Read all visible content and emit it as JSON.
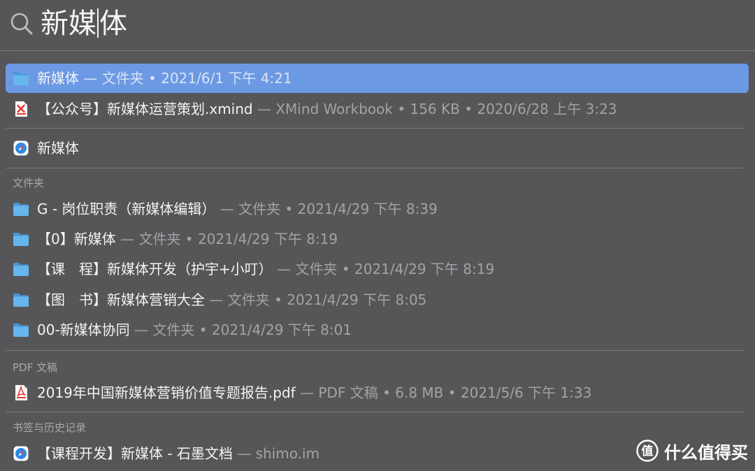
{
  "search": {
    "query_before_cursor": "新媒",
    "query_after_cursor": "体"
  },
  "rows": [
    {
      "icon": "folder-icon",
      "title": "新媒体",
      "meta": " — 文件夹 • 2021/6/1 下午 4:21"
    },
    {
      "icon": "xmind-file-icon",
      "title": "【公众号】新媒体运营策划.xmind",
      "meta": " — XMind Workbook • 156 KB • 2020/6/28 上午 3:23"
    },
    {
      "icon": "safari-icon",
      "title": "新媒体",
      "meta": ""
    },
    {
      "icon": "folder-icon",
      "title": "G - 岗位职责（新媒体编辑）",
      "meta": " — 文件夹 • 2021/4/29 下午 8:39"
    },
    {
      "icon": "folder-icon",
      "title": "【0】新媒体",
      "meta": " — 文件夹 • 2021/4/29 下午 8:19"
    },
    {
      "icon": "folder-icon",
      "title": "【课　程】新媒体开发（护宇+小叮）",
      "meta": " — 文件夹 • 2021/4/29 下午 8:19"
    },
    {
      "icon": "folder-icon",
      "title": "【图　书】新媒体营销大全",
      "meta": " — 文件夹 • 2021/4/29 下午 8:05"
    },
    {
      "icon": "folder-icon",
      "title": "00-新媒体协同",
      "meta": " — 文件夹 • 2021/4/29 下午 8:01"
    },
    {
      "icon": "pdf-file-icon",
      "title": "2019年中国新媒体营销价值专题报告.pdf",
      "meta": " — PDF 文稿 • 6.8 MB • 2021/5/6 下午 1:33"
    },
    {
      "icon": "safari-icon",
      "title": "【课程开发】新媒体 - 石墨文档",
      "meta": " — shimo.im"
    }
  ],
  "sections": {
    "folders": "文件夹",
    "pdf": "PDF 文稿",
    "bookmarks": "书签与历史记录"
  },
  "watermark": {
    "logo_char": "值",
    "text": "什么值得买"
  },
  "colors": {
    "background": "#565659",
    "selection": "#6c99e3",
    "folder": "#5aa9e6"
  }
}
